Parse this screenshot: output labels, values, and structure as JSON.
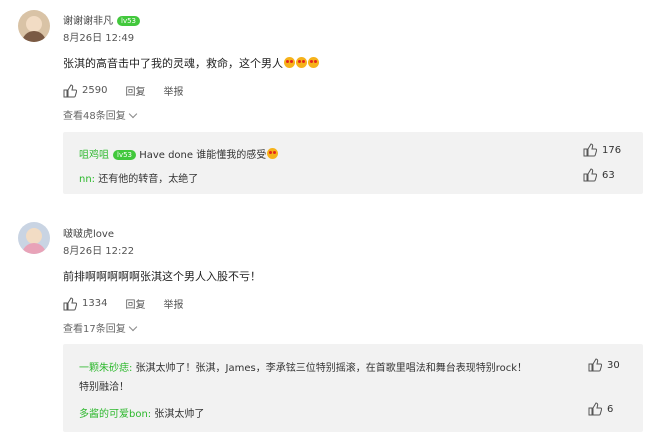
{
  "comments": [
    {
      "user": "谢谢谢非凡",
      "badge": "lv53",
      "time": "8月26日 12:49",
      "text": "张淇的高音击中了我的灵魂，救命，这个男人",
      "likes": "2590",
      "reply_label": "回复",
      "report_label": "举报",
      "more_replies": "查看48条回复",
      "replies": [
        {
          "user": "咀鸡咀",
          "badge": "lv53",
          "text": "Have done 谁能懂我的感受",
          "likes": "176"
        },
        {
          "user": "nn:",
          "text": "还有他的转音，太绝了",
          "likes": "63"
        }
      ]
    },
    {
      "user": "啵啵虎love",
      "time": "8月26日 12:22",
      "text": "前排啊啊啊啊啊张淇这个男人入股不亏！",
      "likes": "1334",
      "reply_label": "回复",
      "report_label": "举报",
      "more_replies": "查看17条回复",
      "replies": [
        {
          "user": "一颗朱砂痣:",
          "text": "张淇太帅了！张淇，James，李承铉三位特别摇滚，在首歌里唱法和舞台表现特别rock！",
          "text2": "特别融洽！",
          "likes": "30"
        },
        {
          "user": "多酱的可爱bon:",
          "text": "张淇太帅了",
          "likes": "6"
        }
      ]
    }
  ]
}
